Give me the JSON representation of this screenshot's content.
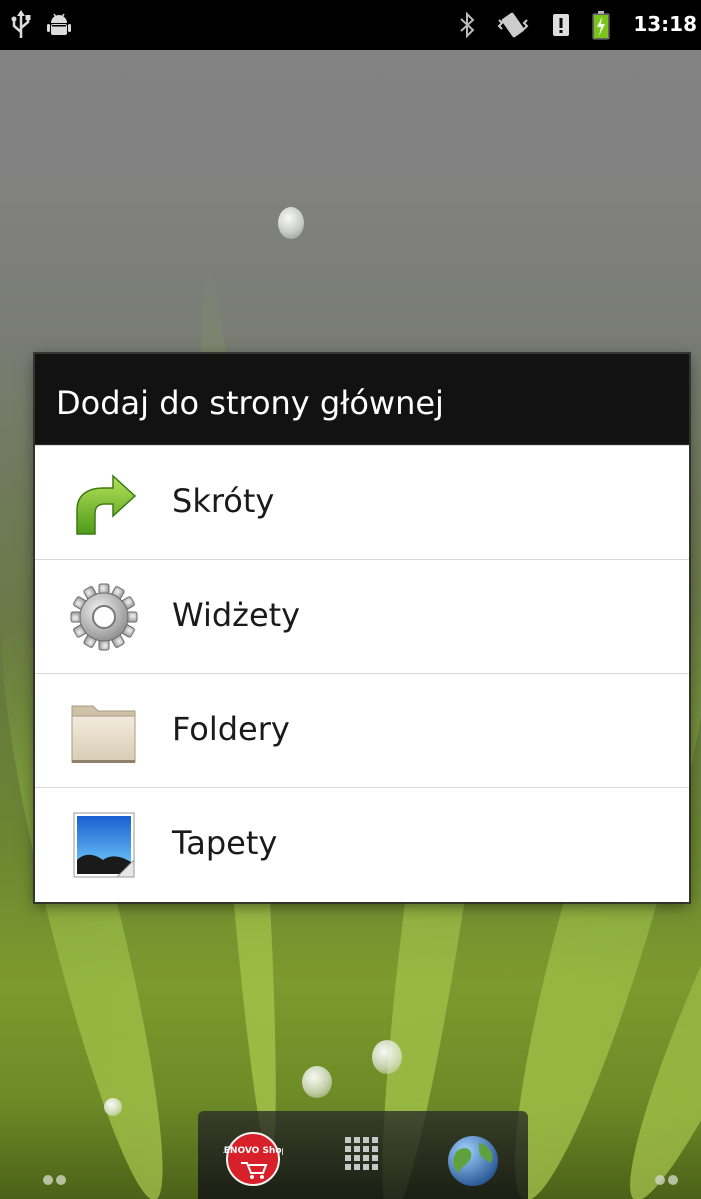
{
  "status_bar": {
    "time": "13:18",
    "icons": [
      "usb-icon",
      "android-debug-icon",
      "bluetooth-icon",
      "vibrate-icon",
      "alert-icon",
      "battery-charging-icon"
    ]
  },
  "dialog": {
    "title": "Dodaj do strony głównej",
    "items": [
      {
        "label": "Skróty",
        "icon": "shortcut-arrow-icon"
      },
      {
        "label": "Widżety",
        "icon": "gear-icon"
      },
      {
        "label": "Foldery",
        "icon": "folder-icon"
      },
      {
        "label": "Tapety",
        "icon": "wallpaper-icon"
      }
    ]
  },
  "dock": {
    "left_app_badge_text": "LENOVO Shop",
    "icons": [
      "lenovo-shop-icon",
      "app-drawer-icon",
      "browser-globe-icon"
    ]
  },
  "colors": {
    "status_bar_bg": "#000000",
    "dialog_title_bg": "#121212",
    "dialog_body_bg": "#ffffff",
    "divider": "#d9d9d9"
  }
}
